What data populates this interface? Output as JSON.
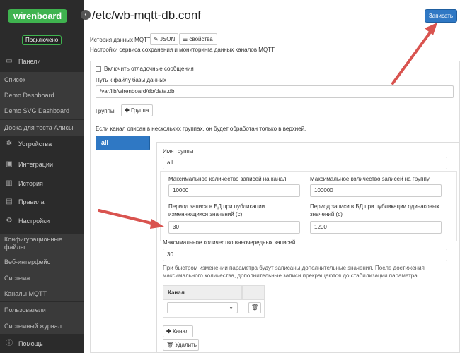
{
  "sidebar": {
    "logo": "wirenboard",
    "status": "Подключено",
    "collapse_icon": "‹",
    "items": [
      {
        "label": "Панели",
        "icon": "monitor-icon",
        "glyph": "▭",
        "sub": false
      },
      {
        "label": "Список",
        "sub": true
      },
      {
        "label": "Demo Dashboard",
        "sub": true
      },
      {
        "label": "Demo SVG Dashboard",
        "sub": true
      },
      {
        "label": "Доска для теста Алисы",
        "sub": true
      },
      {
        "label": "Устройства",
        "icon": "gear-icon",
        "glyph": "✲",
        "sub": false
      },
      {
        "label": "Интеграции",
        "icon": "puzzle-icon",
        "glyph": "▣",
        "sub": false
      },
      {
        "label": "История",
        "icon": "chart-icon",
        "glyph": "▥",
        "sub": false
      },
      {
        "label": "Правила",
        "icon": "document-icon",
        "glyph": "▤",
        "sub": false
      },
      {
        "label": "Настройки",
        "icon": "settings-icon",
        "glyph": "⚙",
        "sub": false
      },
      {
        "label": "Конфигурационные файлы",
        "sub": true
      },
      {
        "label": "Веб-интерфейс",
        "sub": true
      },
      {
        "label": "Система",
        "sub": true
      },
      {
        "label": "Каналы MQTT",
        "sub": true
      },
      {
        "label": "Пользователи",
        "sub": true
      },
      {
        "label": "Системный журнал",
        "sub": true
      },
      {
        "label": "Помощь",
        "icon": "help-icon",
        "glyph": "ⓘ",
        "sub": false
      }
    ]
  },
  "header": {
    "title": "/etc/wb-mqtt-db.conf",
    "save_label": "Записать"
  },
  "editor": {
    "schema_label": "История данных MQTT",
    "json_btn": "JSON",
    "props_btn": "свойства",
    "description": "Настройки сервиса сохранения и мониторинга данных каналов MQTT",
    "debug_label": "Включить отладочные сообщения",
    "db_path_label": "Путь к файлу базы данных",
    "db_path_value": "/var/lib/wirenboard/db/data.db",
    "groups_label": "Группы",
    "add_group_btn": "Группа",
    "groups_note": "Если канал описан в нескольких группах, он будет обработан только в верхней.",
    "group_tab": "all",
    "group_name_label": "Имя группы",
    "group_name_value": "all",
    "max_records_channel_label": "Максимальное количество записей на канал",
    "max_records_channel_value": "10000",
    "max_records_group_label": "Максимальное количество записей на группу",
    "max_records_group_value": "100000",
    "period_changing_label_1": "Период записи в БД при публикации",
    "period_changing_label_2": "изменяющихся значений (с)",
    "period_changing_value": "30",
    "period_same_label_1": "Период записи в БД при публикации одинаковых",
    "period_same_label_2": "значений (с)",
    "period_same_value": "1200",
    "max_burst_label": "Максимальное количество внеочередных записей",
    "max_burst_value": "30",
    "burst_note_1": "При быстром изменении параметра будут записаны дополнительные значения. После достижения",
    "burst_note_2": "максимального количества, дополнительные записи прекращаются до стабилизации параметра",
    "channel_col": "Канал",
    "add_channel_btn": "Канал",
    "delete_btn": "Удалить"
  },
  "colors": {
    "accent": "#2f78c4",
    "brand": "#3fb34f",
    "annotation_arrow": "#d9534f"
  }
}
